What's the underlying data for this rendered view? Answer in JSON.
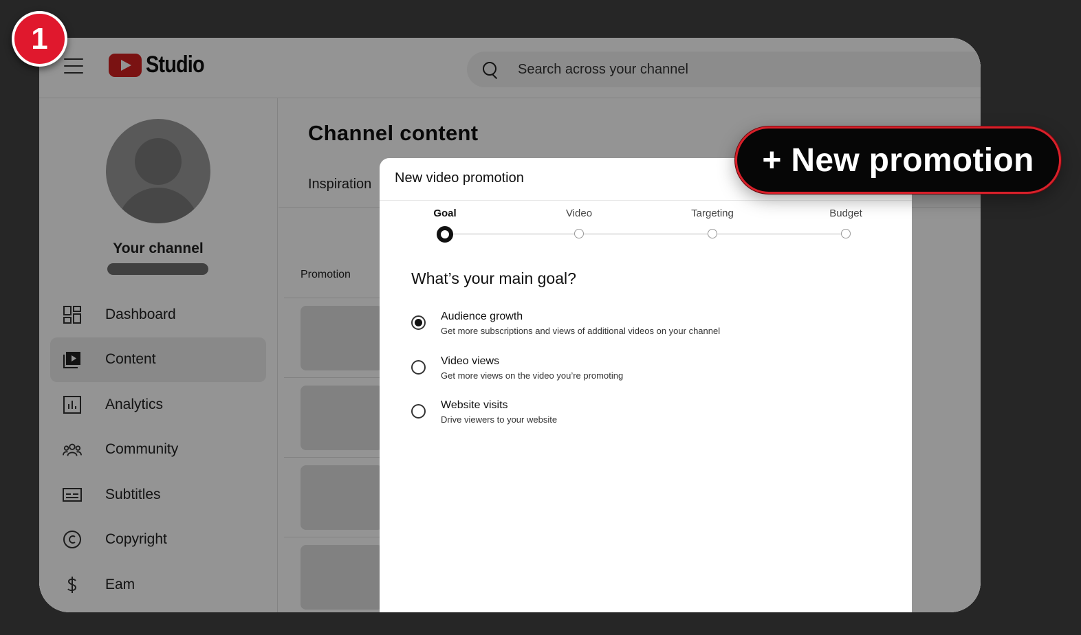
{
  "badge": {
    "number": "1"
  },
  "app": {
    "logo_text": "Studio"
  },
  "search": {
    "placeholder": "Search across your channel"
  },
  "channel": {
    "name": "Your channel"
  },
  "sidebar": {
    "items": [
      {
        "label": "Dashboard",
        "icon": "dashboard-icon"
      },
      {
        "label": "Content",
        "icon": "content-icon"
      },
      {
        "label": "Analytics",
        "icon": "analytics-icon"
      },
      {
        "label": "Community",
        "icon": "community-icon"
      },
      {
        "label": "Subtitles",
        "icon": "subtitles-icon"
      },
      {
        "label": "Copyright",
        "icon": "copyright-icon"
      },
      {
        "label": "Eam",
        "icon": "dollar-icon"
      }
    ]
  },
  "main": {
    "title": "Channel content",
    "tab": "Inspiration",
    "column_header": "Promotion"
  },
  "dialog": {
    "title": "New video promotion",
    "steps": [
      {
        "label": "Goal"
      },
      {
        "label": "Video"
      },
      {
        "label": "Targeting"
      },
      {
        "label": "Budget"
      }
    ],
    "question": "What’s your main goal?",
    "options": [
      {
        "label": "Audience growth",
        "description": "Get more subscriptions and views of additional videos on your channel"
      },
      {
        "label": "Video views",
        "description": "Get more views on the video you’re promoting"
      },
      {
        "label": "Website visits",
        "description": "Drive viewers to your website"
      }
    ]
  },
  "promo_button": {
    "label": "+ New promotion"
  },
  "colors": {
    "accent": "#e0182d",
    "youtube_red": "#d21f1f",
    "button_bg": "#060606"
  }
}
